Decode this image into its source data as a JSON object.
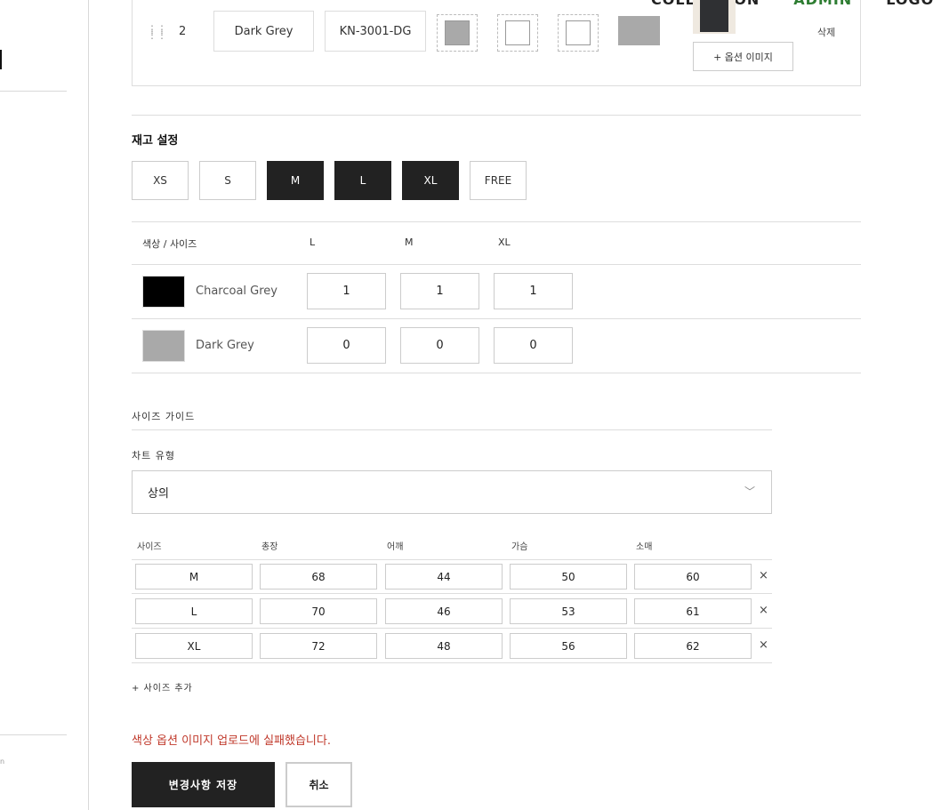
{
  "topnav": {
    "collection": "COLLECTION",
    "admin": "ADMIN",
    "logout": "LOGOUT"
  },
  "colors": {
    "admin_green": "#2e7d32",
    "dark": "#222222",
    "error_red": "#c0392b",
    "charcoal": "#000000",
    "dark_grey": "#a9a9a9"
  },
  "option_row": {
    "number": "2",
    "color_name": "Dark Grey",
    "sku": "KN-3001-DG",
    "add_image_label": "+ 옵션 이미지",
    "delete_label": "삭제"
  },
  "stock": {
    "title": "재고 설정",
    "sizes": [
      {
        "label": "XS",
        "selected": false
      },
      {
        "label": "S",
        "selected": false
      },
      {
        "label": "M",
        "selected": true
      },
      {
        "label": "L",
        "selected": true
      },
      {
        "label": "XL",
        "selected": true
      },
      {
        "label": "FREE",
        "selected": false
      }
    ],
    "header": {
      "corner": "색상 / 사이즈",
      "cols": [
        "L",
        "M",
        "XL"
      ]
    },
    "rows": [
      {
        "name": "Charcoal Grey",
        "qty": [
          "1",
          "1",
          "1"
        ]
      },
      {
        "name": "Dark Grey",
        "qty": [
          "0",
          "0",
          "0"
        ]
      }
    ]
  },
  "size_guide": {
    "title": "사이즈 가이드",
    "chart_type_label": "차트 유형",
    "chart_type_value": "상의",
    "columns": [
      "사이즈",
      "총장",
      "어깨",
      "가슴",
      "소매"
    ],
    "rows": [
      [
        "M",
        "68",
        "44",
        "50",
        "60"
      ],
      [
        "L",
        "70",
        "46",
        "53",
        "61"
      ],
      [
        "XL",
        "72",
        "48",
        "56",
        "62"
      ]
    ],
    "add_size_label": "+ 사이즈 추가",
    "remove_glyph": "×"
  },
  "error_message": "색상 옵션 이미지 업로드에 실패했습니다.",
  "actions": {
    "save_label": "변경사항 저장",
    "cancel_label": "취소"
  }
}
